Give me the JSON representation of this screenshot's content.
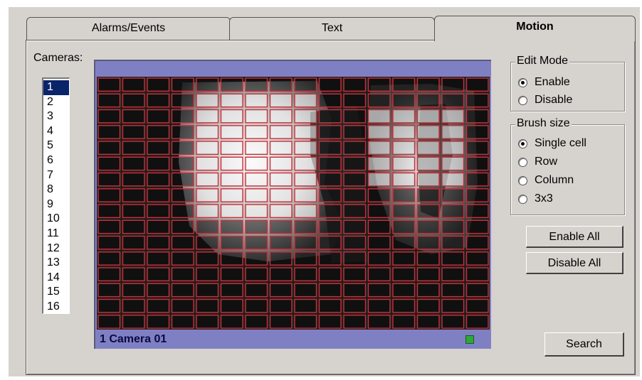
{
  "tabs": [
    {
      "label": "Alarms/Events",
      "active": false
    },
    {
      "label": "Text",
      "active": false
    },
    {
      "label": "Motion",
      "active": true
    }
  ],
  "cameras": {
    "label": "Cameras:",
    "items": [
      "1",
      "2",
      "3",
      "4",
      "5",
      "6",
      "7",
      "8",
      "9",
      "10",
      "11",
      "12",
      "13",
      "14",
      "15",
      "16"
    ],
    "selected": "1"
  },
  "video": {
    "caption": "1 Camera 01",
    "grid_columns": 16,
    "grid_rows": 16,
    "enabled_cell_color": "#ffffff",
    "grid_line_color": "#c8303a",
    "status_indicator_color": "#2ea83a"
  },
  "edit_mode": {
    "title": "Edit Mode",
    "options": [
      "Enable",
      "Disable"
    ],
    "selected": "Enable"
  },
  "brush_size": {
    "title": "Brush size",
    "options": [
      "Single cell",
      "Row",
      "Column",
      "3x3"
    ],
    "selected": "Single cell"
  },
  "buttons": {
    "enable_all": "Enable All",
    "disable_all": "Disable All",
    "search": "Search"
  }
}
